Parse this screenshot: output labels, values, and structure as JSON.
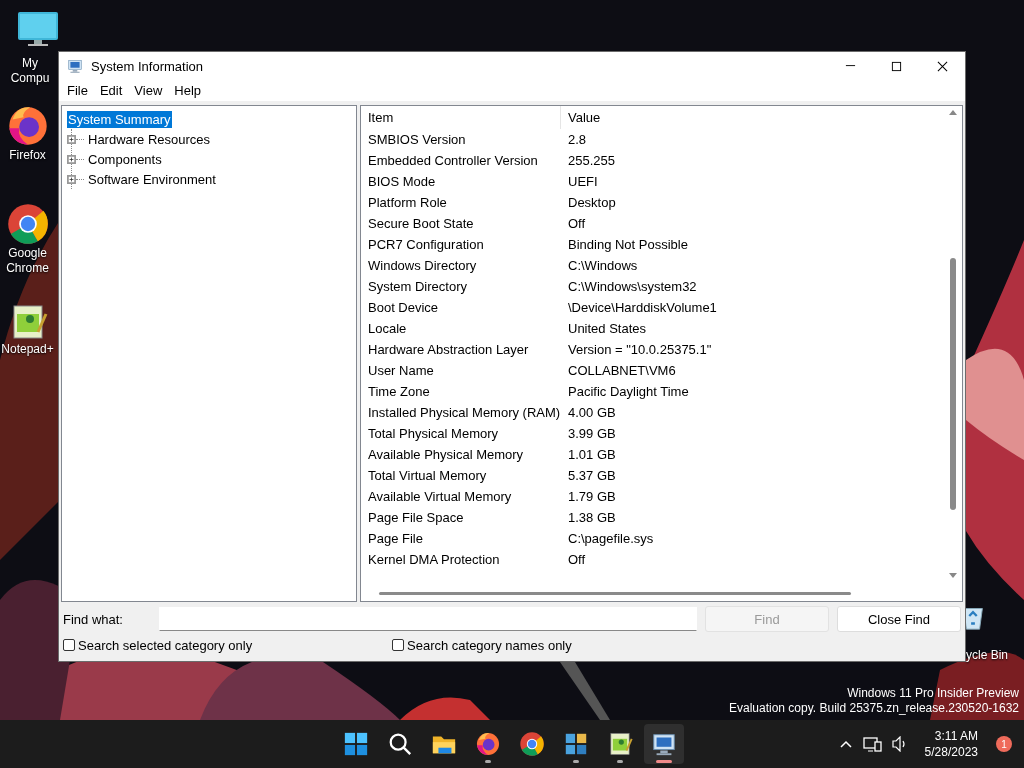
{
  "desktop_icons": [
    {
      "kind": "monitor",
      "label": "My Compu"
    },
    {
      "kind": "firefox",
      "label": "Firefox"
    },
    {
      "kind": "chrome",
      "label": "Google Chrome"
    },
    {
      "kind": "notepad",
      "label": "Notepad+"
    },
    {
      "kind": "recycle",
      "label": "ycle Bin"
    }
  ],
  "window": {
    "title": "System Information",
    "menu": [
      "File",
      "Edit",
      "View",
      "Help"
    ],
    "tree": {
      "label": "System Summary",
      "selected": true,
      "expanded": true,
      "children": [
        {
          "label": "Hardware Resources",
          "selected": false,
          "expanded": false
        },
        {
          "label": "Components",
          "selected": false,
          "expanded": false
        },
        {
          "label": "Software Environment",
          "selected": false,
          "expanded": false
        }
      ]
    },
    "table": {
      "columns": [
        "Item",
        "Value"
      ],
      "rows": [
        [
          "SMBIOS Version",
          "2.8"
        ],
        [
          "Embedded Controller Version",
          "255.255"
        ],
        [
          "BIOS Mode",
          "UEFI"
        ],
        [
          "Platform Role",
          "Desktop"
        ],
        [
          "Secure Boot State",
          "Off"
        ],
        [
          "PCR7 Configuration",
          "Binding Not Possible"
        ],
        [
          "Windows Directory",
          "C:\\Windows"
        ],
        [
          "System Directory",
          "C:\\Windows\\system32"
        ],
        [
          "Boot Device",
          "\\Device\\HarddiskVolume1"
        ],
        [
          "Locale",
          "United States"
        ],
        [
          "Hardware Abstraction Layer",
          "Version = \"10.0.25375.1\""
        ],
        [
          "User Name",
          "COLLABNET\\VM6"
        ],
        [
          "Time Zone",
          "Pacific Daylight Time"
        ],
        [
          "Installed Physical Memory (RAM)",
          "4.00 GB"
        ],
        [
          "Total Physical Memory",
          "3.99 GB"
        ],
        [
          "Available Physical Memory",
          "1.01 GB"
        ],
        [
          "Total Virtual Memory",
          "5.37 GB"
        ],
        [
          "Available Virtual Memory",
          "1.79 GB"
        ],
        [
          "Page File Space",
          "1.38 GB"
        ],
        [
          "Page File",
          "C:\\pagefile.sys"
        ],
        [
          "Kernel DMA Protection",
          "Off"
        ]
      ]
    },
    "find": {
      "label": "Find what:",
      "buttons": [
        {
          "label": "Find",
          "disabled": true
        },
        {
          "label": "Close Find",
          "disabled": false
        }
      ],
      "checkboxes": [
        {
          "label": "Search selected category only",
          "checked": false
        },
        {
          "label": "Search category names only",
          "checked": false
        }
      ]
    }
  },
  "watermark": [
    "Windows 11 Pro Insider Preview",
    "Evaluation copy. Build 25375.zn_release.230520-1632"
  ],
  "taskbar": {
    "apps": [
      {
        "kind": "start",
        "running": false,
        "active": false
      },
      {
        "kind": "search",
        "running": false,
        "active": false
      },
      {
        "kind": "folder",
        "running": false,
        "active": false
      },
      {
        "kind": "firefox",
        "running": true,
        "active": false
      },
      {
        "kind": "chrome",
        "running": false,
        "active": false
      },
      {
        "kind": "tiles",
        "running": true,
        "active": false
      },
      {
        "kind": "notepad",
        "running": true,
        "active": false
      },
      {
        "kind": "sysinfo",
        "running": true,
        "active": true
      }
    ],
    "time": "3:11 AM",
    "date": "5/28/2023",
    "badge": "1"
  }
}
